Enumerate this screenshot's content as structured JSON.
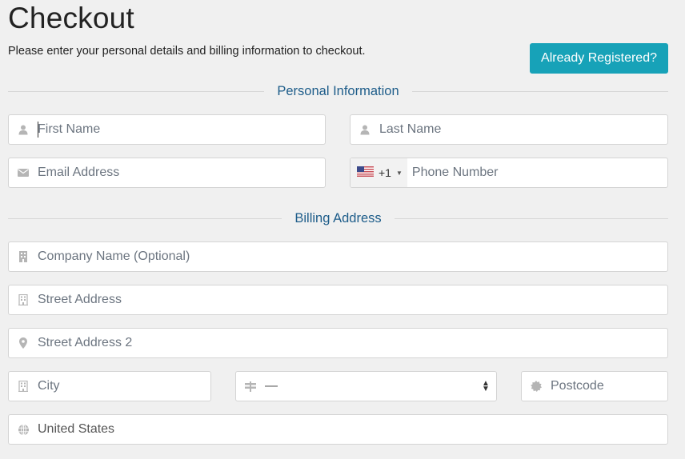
{
  "header": {
    "title": "Checkout",
    "subtitle": "Please enter your personal details and billing information to checkout.",
    "already_registered_label": "Already Registered?"
  },
  "colors": {
    "accent": "#17a2b8",
    "section_label": "#1e5d8a",
    "background": "#f0f0f0"
  },
  "personal": {
    "section_label": "Personal Information",
    "first_name": {
      "placeholder": "First Name",
      "value": "",
      "icon": "user-icon"
    },
    "last_name": {
      "placeholder": "Last Name",
      "value": "",
      "icon": "user-icon"
    },
    "email": {
      "placeholder": "Email Address",
      "value": "",
      "icon": "envelope-icon"
    },
    "phone": {
      "placeholder": "Phone Number",
      "value": "",
      "country_flag": "us-flag-icon",
      "dial_code": "+1"
    }
  },
  "billing": {
    "section_label": "Billing Address",
    "company": {
      "placeholder": "Company Name (Optional)",
      "value": "",
      "icon": "building-icon"
    },
    "street": {
      "placeholder": "Street Address",
      "value": "",
      "icon": "building-outline-icon"
    },
    "street2": {
      "placeholder": "Street Address 2",
      "value": "",
      "icon": "map-marker-icon"
    },
    "city": {
      "placeholder": "City",
      "value": "",
      "icon": "building-outline-icon"
    },
    "state": {
      "selected": "—",
      "icon": "signpost-icon"
    },
    "postcode": {
      "placeholder": "Postcode",
      "value": "",
      "icon": "certificate-icon"
    },
    "country": {
      "value": "United States",
      "icon": "globe-icon"
    }
  }
}
